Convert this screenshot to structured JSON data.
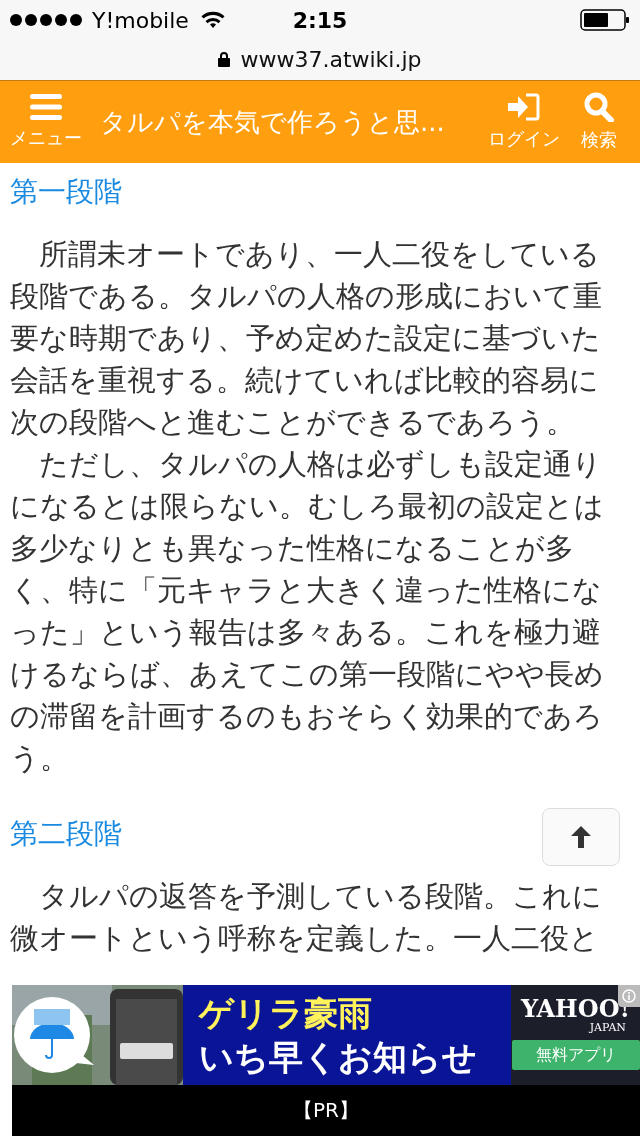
{
  "status_bar": {
    "carrier": "Y!mobile",
    "time": "2:15"
  },
  "browser": {
    "url": "www37.atwiki.jp",
    "secure": true
  },
  "header": {
    "menu_label": "メニュー",
    "title": "タルパを本気で作ろうと思...",
    "login_label": "ログイン",
    "search_label": "検索"
  },
  "sections": [
    {
      "heading": "第一段階",
      "paragraphs": [
        "　所謂未オートであり、一人二役をしている段階である。タルパの人格の形成において重要な時期であり、予め定めた設定に基づいた会話を重視する。続けていれば比較的容易に次の段階へと進むことができるであろう。",
        "　ただし、タルパの人格は必ずしも設定通りになるとは限らない。むしろ最初の設定とは多少なりとも異なった性格になることが多く、特に「元キャラと大きく違った性格になった」という報告は多々ある。これを極力避けるならば、あえてこの第一段階にやや長めの滞留を計画するのもおそらく効果的であろう。"
      ]
    },
    {
      "heading": "第二段階",
      "paragraphs": [
        "　タルパの返答を予測している段階。これに微オートという呼称を定義した。一人二役と"
      ]
    }
  ],
  "ad": {
    "headline_1": "ゲリラ豪雨",
    "headline_2": "いち早くお知らせ",
    "brand": "YAHOO!",
    "brand_sub": "JAPAN",
    "cta": "無料アプリ",
    "footer": "【PR】"
  }
}
